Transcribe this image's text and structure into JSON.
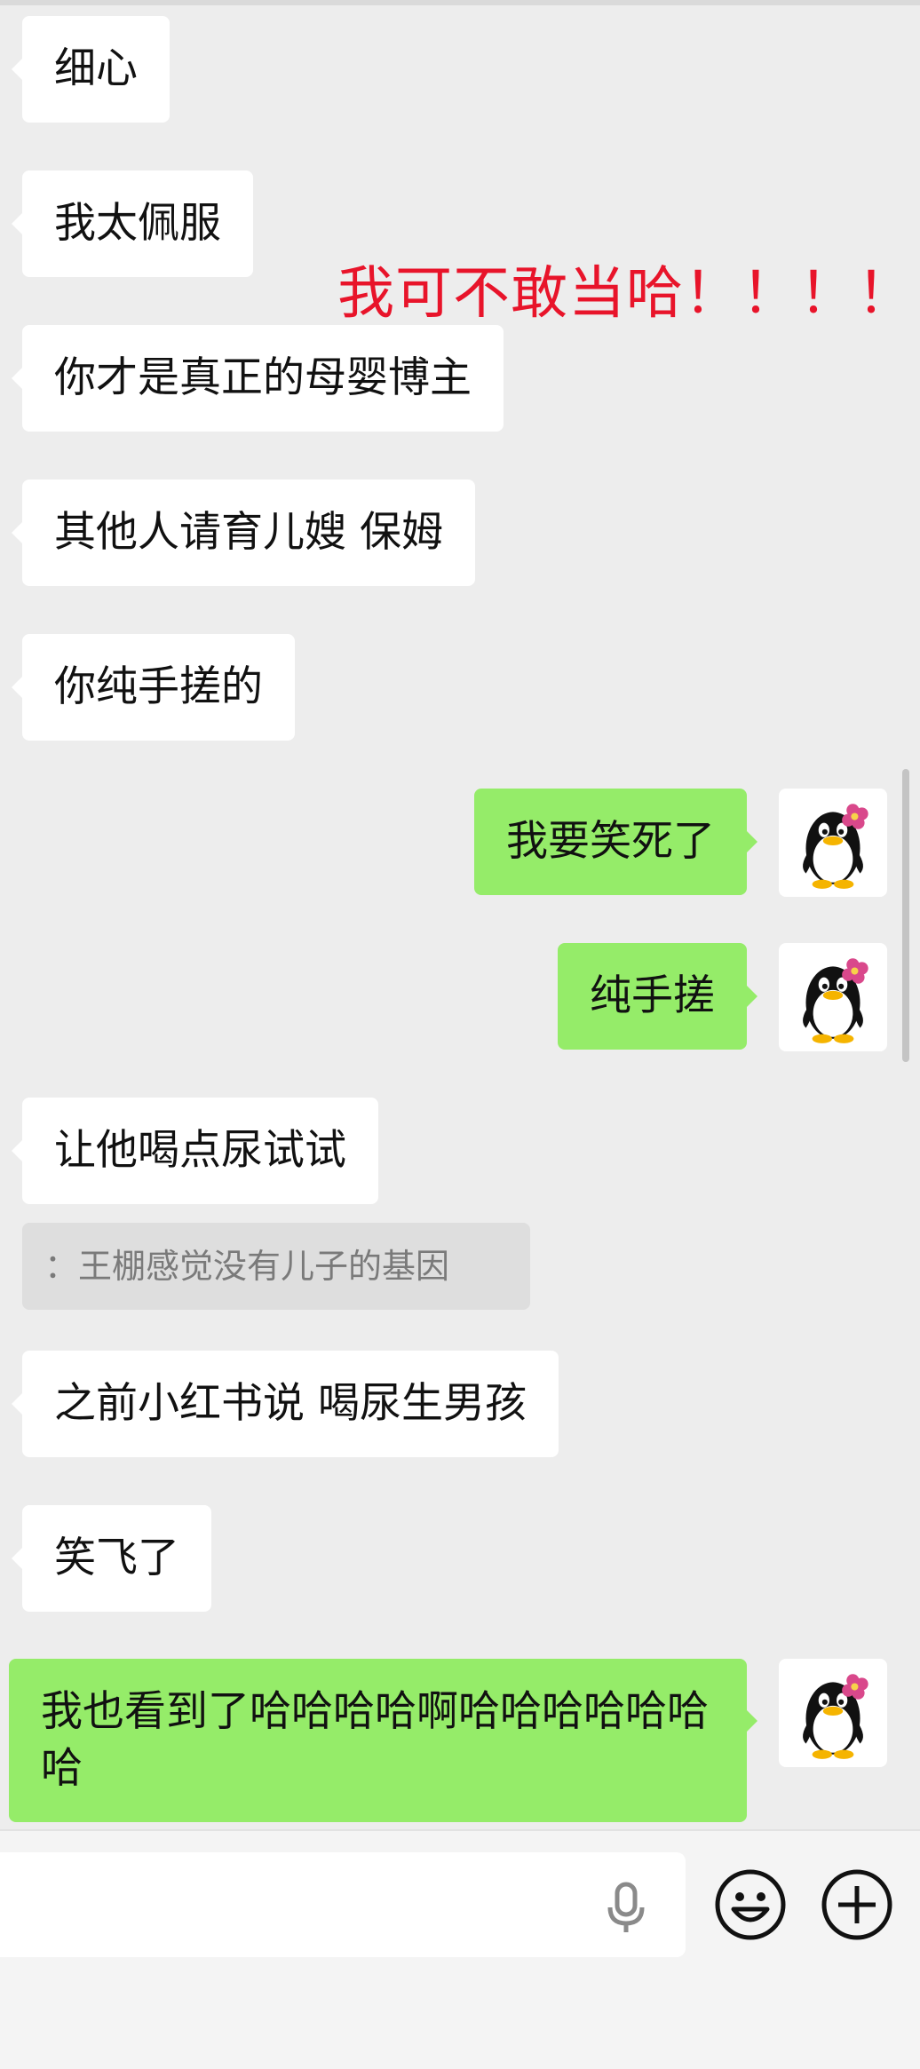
{
  "overlay_text": "我可不敢当哈！！！！",
  "messages": [
    {
      "side": "left",
      "text": "细心"
    },
    {
      "side": "left",
      "text": "我太佩服"
    },
    {
      "side": "left",
      "text": "你才是真正的母婴博主"
    },
    {
      "side": "left",
      "text": "其他人请育儿嫂 保姆"
    },
    {
      "side": "left",
      "text": "你纯手搓的"
    },
    {
      "side": "right",
      "text": "我要笑死了"
    },
    {
      "side": "right",
      "text": "纯手搓"
    },
    {
      "side": "left",
      "text": "让他喝点尿试试"
    },
    {
      "side": "left",
      "text": "之前小红书说 喝尿生男孩"
    },
    {
      "side": "left",
      "text": "笑飞了"
    },
    {
      "side": "right",
      "text": "我也看到了哈哈哈哈啊哈哈哈哈哈哈哈"
    }
  ],
  "quote": {
    "text": "：王棚感觉没有儿子的基因"
  },
  "avatar": {
    "icon": "penguin-with-pink-flower-icon"
  },
  "input_bar": {
    "input_value": "",
    "icons": [
      "microphone-icon",
      "emoji-icon",
      "plus-icon"
    ]
  },
  "colors": {
    "background": "#ededed",
    "left_bubble": "#ffffff",
    "right_bubble": "#95ec69",
    "overlay_text": "#e8142a",
    "quote_bg": "#dedede"
  }
}
